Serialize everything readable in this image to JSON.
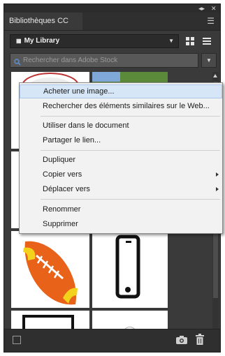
{
  "panel": {
    "tab_title": "Bibliothèques CC",
    "library_select": "My Library",
    "search_placeholder": "Rechercher dans Adobe Stock"
  },
  "context_menu": {
    "items": [
      {
        "label": "Acheter une image...",
        "highlighted": true,
        "submenu": false
      },
      {
        "label": "Rechercher des éléments similaires sur le Web...",
        "highlighted": false,
        "submenu": false
      },
      {
        "label": "Utiliser dans le document",
        "highlighted": false,
        "submenu": false
      },
      {
        "label": "Partager le lien...",
        "highlighted": false,
        "submenu": false
      },
      {
        "label": "Dupliquer",
        "highlighted": false,
        "submenu": false
      },
      {
        "label": "Copier vers",
        "highlighted": false,
        "submenu": true
      },
      {
        "label": "Déplacer vers",
        "highlighted": false,
        "submenu": true
      },
      {
        "label": "Renommer",
        "highlighted": false,
        "submenu": false
      },
      {
        "label": "Supprimer",
        "highlighted": false,
        "submenu": false
      }
    ]
  },
  "icons": {
    "collapse": "double-arrow-icon",
    "close": "close-icon",
    "panel_menu": "panel-menu-icon",
    "library": "library-icon",
    "grid_view": "grid-view-icon",
    "list_view": "list-view-icon",
    "search": "search-icon",
    "dropdown": "chevron-down-icon",
    "camera": "camera-icon",
    "trash": "trash-icon"
  },
  "colors": {
    "panel_bg": "#3a3a3a",
    "menu_bg": "#f2f2f2",
    "menu_highlight": "#d7e6f6",
    "football": "#e8621a",
    "football_stripe": "#f2d21b"
  }
}
